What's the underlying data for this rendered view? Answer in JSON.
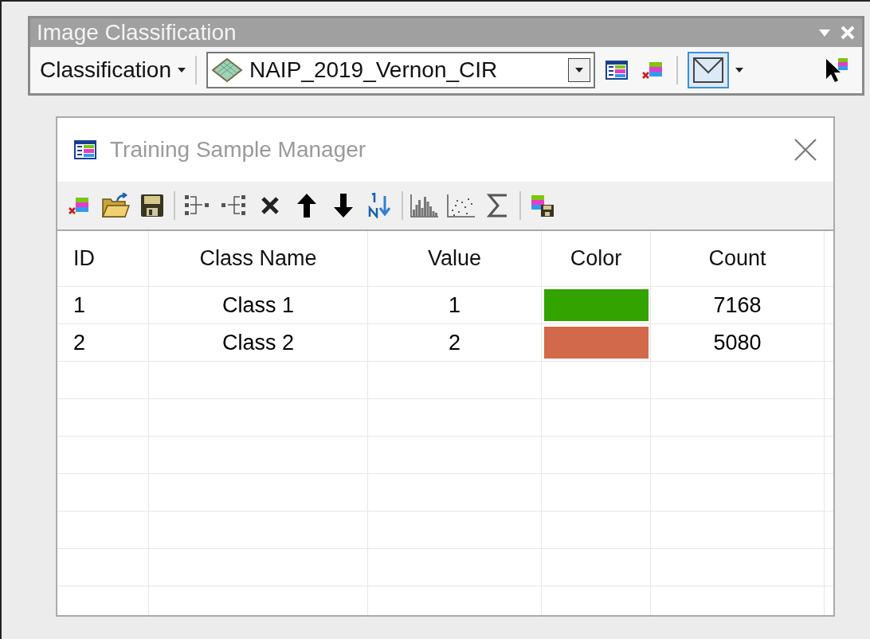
{
  "toolbar": {
    "title": "Image Classification",
    "menu": "Classification",
    "layer": "NAIP_2019_Vernon_CIR",
    "tools": [
      {
        "kind": "manager",
        "selected": false
      },
      {
        "kind": "clear",
        "selected": false
      },
      {
        "kind": "preview",
        "selected": true
      },
      {
        "kind": "pointer",
        "selected": false
      }
    ]
  },
  "dialog": {
    "title": "Training Sample Manager",
    "table": {
      "columns": [
        "ID",
        "Class Name",
        "Value",
        "Color",
        "Count"
      ],
      "rows": [
        {
          "id": "1",
          "class_name": "Class 1",
          "value": "1",
          "color": "#33a300",
          "count": "7168"
        },
        {
          "id": "2",
          "class_name": "Class 2",
          "value": "2",
          "color": "#d2694b",
          "count": "5080"
        }
      ]
    }
  }
}
